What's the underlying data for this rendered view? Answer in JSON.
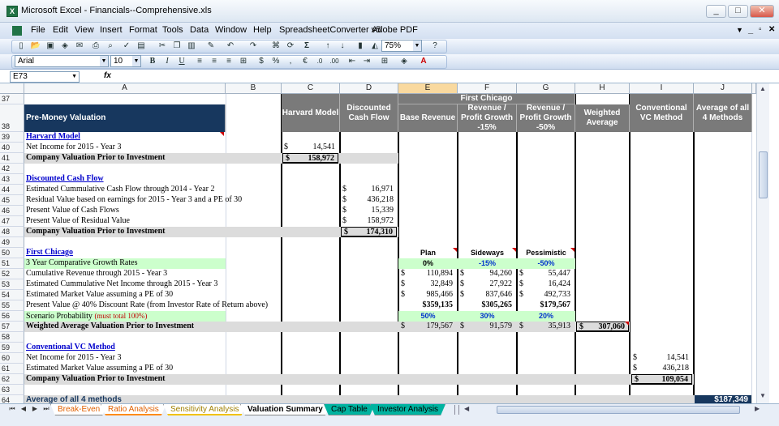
{
  "window": {
    "title": "Microsoft Excel - Financials--Comprehensive.xls",
    "controls": [
      "_",
      "□",
      "✕"
    ],
    "doc_controls": [
      "_",
      "✕"
    ]
  },
  "menus": [
    "File",
    "Edit",
    "View",
    "Insert",
    "Format",
    "Tools",
    "Data",
    "Window",
    "Help",
    "SpreadsheetConverter v5",
    "Adobe PDF"
  ],
  "help_placeholder": "Type a question for help",
  "toolbar": {
    "zoom": "75%",
    "font": "Arial",
    "size": "10",
    "sum": "Σ",
    "bold": "B",
    "italic": "I",
    "underline": "U",
    "currency": "$",
    "percent": "%",
    "comma": ",",
    "euro": "€"
  },
  "formula_bar": {
    "name_box": "E73",
    "fx": "fx",
    "content": ""
  },
  "columns": [
    "A",
    "B",
    "C",
    "D",
    "E",
    "F",
    "G",
    "H",
    "I",
    "J"
  ],
  "selected_column": "E",
  "rows": [
    "37",
    "38",
    "39",
    "40",
    "41",
    "42",
    "43",
    "44",
    "45",
    "46",
    "47",
    "48",
    "49",
    "50",
    "51",
    "52",
    "53",
    "54",
    "55",
    "56",
    "57",
    "58",
    "59",
    "60",
    "61",
    "62",
    "63",
    "64"
  ],
  "headers": {
    "pre_money": "Pre-Money Valuation",
    "harvard": "Harvard Model",
    "dcf": "Discounted Cash Flow",
    "first_chicago": "First Chicago",
    "base_revenue": "Base Revenue",
    "rev15": "Revenue / Profit Growth -15%",
    "rev50": "Revenue / Profit Growth -50%",
    "weighted": "Weighted Average",
    "conv_vc": "Conventional VC Method",
    "avg4": "Average of all 4 Methods"
  },
  "a_labels": {
    "r39": "Harvard Model",
    "r40": "Net Income for 2015 - Year 3",
    "r41": "Company Valuation Prior to Investment",
    "r43": "Discounted Cash Flow",
    "r44": "Estimated Cummulative Cash Flow through 2014 - Year 2",
    "r45": "Residual Value based on earnings for 2015 - Year 3 and a PE of 30",
    "r46": "Present Value of Cash Flows",
    "r47": "Present Value of Residual Value",
    "r48": "Company Valuation Prior to Investment",
    "r50": "First Chicago",
    "r51": "3 Year Comparative Growth Rates",
    "r52": "Cumulative Revenue through 2015 - Year 3",
    "r53": "Estimated Cummulative Net Income through 2015 - Year 3",
    "r54": "Estimated Market Value assuming a PE of 30",
    "r55": "Present Value @ 40% Discount Rate (from Investor Rate of Return above)",
    "r56": "Scenario Probability",
    "r56_note": "(must total 100%)",
    "r57": "Weighted Average Valuation Prior to Investment",
    "r59": "Conventional VC Method",
    "r60": "Net Income for 2015 - Year 3",
    "r61": "Estimated Market Value assuming a PE of 30",
    "r62": "Company Valuation Prior to Investment",
    "r64": "Average of all 4 methods"
  },
  "values": {
    "dollar": "$",
    "c40": "14,541",
    "c41": "158,972",
    "d44": "16,971",
    "d45": "436,218",
    "d46": "15,339",
    "d47": "158,972",
    "d48": "174,310",
    "e50": "Plan",
    "f50": "Sideways",
    "g50": "Pessimistic",
    "e51": "0%",
    "f51": "-15%",
    "g51": "-50%",
    "e52": "110,894",
    "f52": "94,260",
    "g52": "55,447",
    "e53": "32,849",
    "f53": "27,922",
    "g53": "16,424",
    "e54": "985,466",
    "f54": "837,646",
    "g54": "492,733",
    "e55": "$359,135",
    "f55": "$305,265",
    "g55": "$179,567",
    "e56": "50%",
    "f56": "30%",
    "g56": "20%",
    "e57": "179,567",
    "f57": "91,579",
    "g57": "35,913",
    "h57": "307,060",
    "i60": "14,541",
    "i61": "436,218",
    "i62": "109,054",
    "j64": "$187,349"
  },
  "sheet_tabs": [
    {
      "label": "Break-Even",
      "color": "#ff8c1a",
      "active": false
    },
    {
      "label": "Ratio Analysis",
      "color": "#ff8c1a",
      "active": false
    },
    {
      "label": "Sensitivity Analysis",
      "color": "#f2c200",
      "active": false
    },
    {
      "label": "Valuation Summary",
      "color": "#ffffff",
      "active": true
    },
    {
      "label": "Cap Table",
      "color": "#00b3a0",
      "active": false
    },
    {
      "label": "Investor Analysis",
      "color": "#00b3a0",
      "active": false
    }
  ],
  "colors": {
    "header_navy": "#17375e",
    "header_gray": "#7a7a7a",
    "light_green": "#ccffcc",
    "row_gray": "#dcdcdc"
  }
}
